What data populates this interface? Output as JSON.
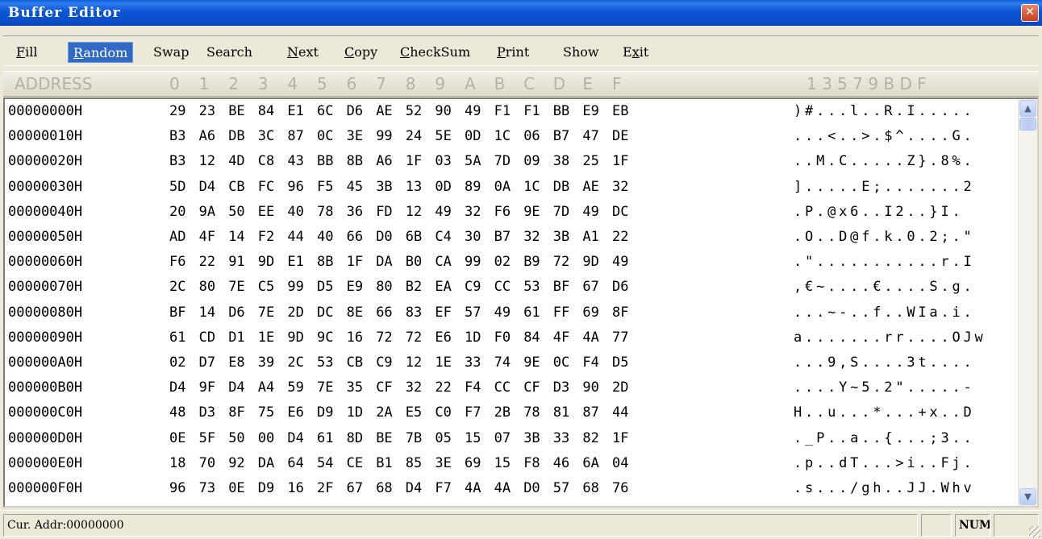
{
  "window": {
    "title": "Buffer Editor",
    "close_glyph": "✕"
  },
  "menu": [
    {
      "underline": "F",
      "rest": "ill",
      "active": false
    },
    {
      "underline": "R",
      "rest": "andom",
      "active": true
    },
    {
      "underline": "",
      "rest": "Swap",
      "active": false
    },
    {
      "underline": "",
      "rest": "Search",
      "active": false
    },
    {
      "underline": "N",
      "rest": "ext",
      "active": false
    },
    {
      "underline": "C",
      "rest": "opy",
      "active": false
    },
    {
      "underline": "C",
      "rest": "heckSum",
      "active": false
    },
    {
      "underline": "P",
      "rest": "rint",
      "active": false
    },
    {
      "underline": "",
      "rest": "Show",
      "active": false
    },
    {
      "underline": "E",
      "rest": "xit",
      "prefix": "E",
      "active": false
    }
  ],
  "header": {
    "address": "ADDRESS",
    "hex_cols": [
      "0",
      "1",
      "2",
      "3",
      "4",
      "5",
      "6",
      "7",
      "8",
      "9",
      "A",
      "B",
      "C",
      "D",
      "E",
      "F"
    ],
    "ascii": "1 3 5 7 9 B D F"
  },
  "rows": [
    {
      "addr": "00000000H",
      "bytes": [
        "29",
        "23",
        "BE",
        "84",
        "E1",
        "6C",
        "D6",
        "AE",
        "52",
        "90",
        "49",
        "F1",
        "F1",
        "BB",
        "E9",
        "EB"
      ],
      "ascii": ")#...l..R.I....."
    },
    {
      "addr": "00000010H",
      "bytes": [
        "B3",
        "A6",
        "DB",
        "3C",
        "87",
        "0C",
        "3E",
        "99",
        "24",
        "5E",
        "0D",
        "1C",
        "06",
        "B7",
        "47",
        "DE"
      ],
      "ascii": "...<..>.$^....G."
    },
    {
      "addr": "00000020H",
      "bytes": [
        "B3",
        "12",
        "4D",
        "C8",
        "43",
        "BB",
        "8B",
        "A6",
        "1F",
        "03",
        "5A",
        "7D",
        "09",
        "38",
        "25",
        "1F"
      ],
      "ascii": "..M.C.....Z}.8%."
    },
    {
      "addr": "00000030H",
      "bytes": [
        "5D",
        "D4",
        "CB",
        "FC",
        "96",
        "F5",
        "45",
        "3B",
        "13",
        "0D",
        "89",
        "0A",
        "1C",
        "DB",
        "AE",
        "32"
      ],
      "ascii": "].....E;.......2"
    },
    {
      "addr": "00000040H",
      "bytes": [
        "20",
        "9A",
        "50",
        "EE",
        "40",
        "78",
        "36",
        "FD",
        "12",
        "49",
        "32",
        "F6",
        "9E",
        "7D",
        "49",
        "DC"
      ],
      "ascii": " .P.@x6..I2..}I."
    },
    {
      "addr": "00000050H",
      "bytes": [
        "AD",
        "4F",
        "14",
        "F2",
        "44",
        "40",
        "66",
        "D0",
        "6B",
        "C4",
        "30",
        "B7",
        "32",
        "3B",
        "A1",
        "22"
      ],
      "ascii": ".O..D@f.k.0.2;.\""
    },
    {
      "addr": "00000060H",
      "bytes": [
        "F6",
        "22",
        "91",
        "9D",
        "E1",
        "8B",
        "1F",
        "DA",
        "B0",
        "CA",
        "99",
        "02",
        "B9",
        "72",
        "9D",
        "49"
      ],
      "ascii": ".\"...........r.I"
    },
    {
      "addr": "00000070H",
      "bytes": [
        "2C",
        "80",
        "7E",
        "C5",
        "99",
        "D5",
        "E9",
        "80",
        "B2",
        "EA",
        "C9",
        "CC",
        "53",
        "BF",
        "67",
        "D6"
      ],
      "ascii": ",€~....€....S.g."
    },
    {
      "addr": "00000080H",
      "bytes": [
        "BF",
        "14",
        "D6",
        "7E",
        "2D",
        "DC",
        "8E",
        "66",
        "83",
        "EF",
        "57",
        "49",
        "61",
        "FF",
        "69",
        "8F"
      ],
      "ascii": "...~-..f..WIa.i."
    },
    {
      "addr": "00000090H",
      "bytes": [
        "61",
        "CD",
        "D1",
        "1E",
        "9D",
        "9C",
        "16",
        "72",
        "72",
        "E6",
        "1D",
        "F0",
        "84",
        "4F",
        "4A",
        "77"
      ],
      "ascii": "a.......rr....OJw"
    },
    {
      "addr": "000000A0H",
      "bytes": [
        "02",
        "D7",
        "E8",
        "39",
        "2C",
        "53",
        "CB",
        "C9",
        "12",
        "1E",
        "33",
        "74",
        "9E",
        "0C",
        "F4",
        "D5"
      ],
      "ascii": "...9,S....3t...."
    },
    {
      "addr": "000000B0H",
      "bytes": [
        "D4",
        "9F",
        "D4",
        "A4",
        "59",
        "7E",
        "35",
        "CF",
        "32",
        "22",
        "F4",
        "CC",
        "CF",
        "D3",
        "90",
        "2D"
      ],
      "ascii": "....Y~5.2\".....-"
    },
    {
      "addr": "000000C0H",
      "bytes": [
        "48",
        "D3",
        "8F",
        "75",
        "E6",
        "D9",
        "1D",
        "2A",
        "E5",
        "C0",
        "F7",
        "2B",
        "78",
        "81",
        "87",
        "44"
      ],
      "ascii": "H..u...*...+x..D"
    },
    {
      "addr": "000000D0H",
      "bytes": [
        "0E",
        "5F",
        "50",
        "00",
        "D4",
        "61",
        "8D",
        "BE",
        "7B",
        "05",
        "15",
        "07",
        "3B",
        "33",
        "82",
        "1F"
      ],
      "ascii": "._P..a..{...;3.."
    },
    {
      "addr": "000000E0H",
      "bytes": [
        "18",
        "70",
        "92",
        "DA",
        "64",
        "54",
        "CE",
        "B1",
        "85",
        "3E",
        "69",
        "15",
        "F8",
        "46",
        "6A",
        "04"
      ],
      "ascii": ".p..dT...>i..Fj."
    },
    {
      "addr": "000000F0H",
      "bytes": [
        "96",
        "73",
        "0E",
        "D9",
        "16",
        "2F",
        "67",
        "68",
        "D4",
        "F7",
        "4A",
        "4A",
        "D0",
        "57",
        "68",
        "76"
      ],
      "ascii": ".s.../gh..JJ.Whv"
    }
  ],
  "scrollbar": {
    "up_glyph": "▲",
    "down_glyph": "▼"
  },
  "status": {
    "cur_addr": "Cur. Addr:00000000",
    "num": "NUM"
  },
  "colors": {
    "title_bar": "#0a56d4",
    "menu_active": "#316ac5",
    "window_bg": "#ece9d8"
  }
}
